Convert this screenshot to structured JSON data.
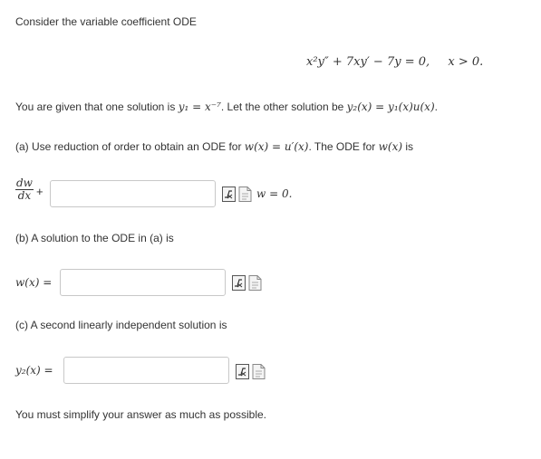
{
  "problem": {
    "intro": "Consider the variable coefficient ODE",
    "ode": "x²y″ + 7xy′ − 7y = 0,",
    "domain": "x > 0.",
    "given_prefix": "You are given that one solution is ",
    "y1_expr": "y₁ = x⁻⁷",
    "given_mid": ". Let the other solution be ",
    "y2_expr": "y₂(x) = y₁(x)u(x)",
    "given_end": "."
  },
  "part_a": {
    "prompt_prefix": "(a) Use reduction of order to obtain an ODE for ",
    "w_def": "w(x) = u′(x)",
    "prompt_mid": ". The ODE for ",
    "w_of_x": "w(x)",
    "prompt_end": " is",
    "frac_num": "dw",
    "frac_den": "dx",
    "plus": "+",
    "suffix": "w = 0.",
    "input_value": ""
  },
  "part_b": {
    "prompt": "(b) A solution to the ODE in (a) is",
    "label": "w(x) =",
    "input_value": ""
  },
  "part_c": {
    "prompt": "(c) A second linearly independent solution is",
    "label": "y₂(x) =",
    "input_value": ""
  },
  "footer": "You must simplify your answer as much as possible.",
  "icons": [
    "formula-editor-icon",
    "preview-icon"
  ]
}
